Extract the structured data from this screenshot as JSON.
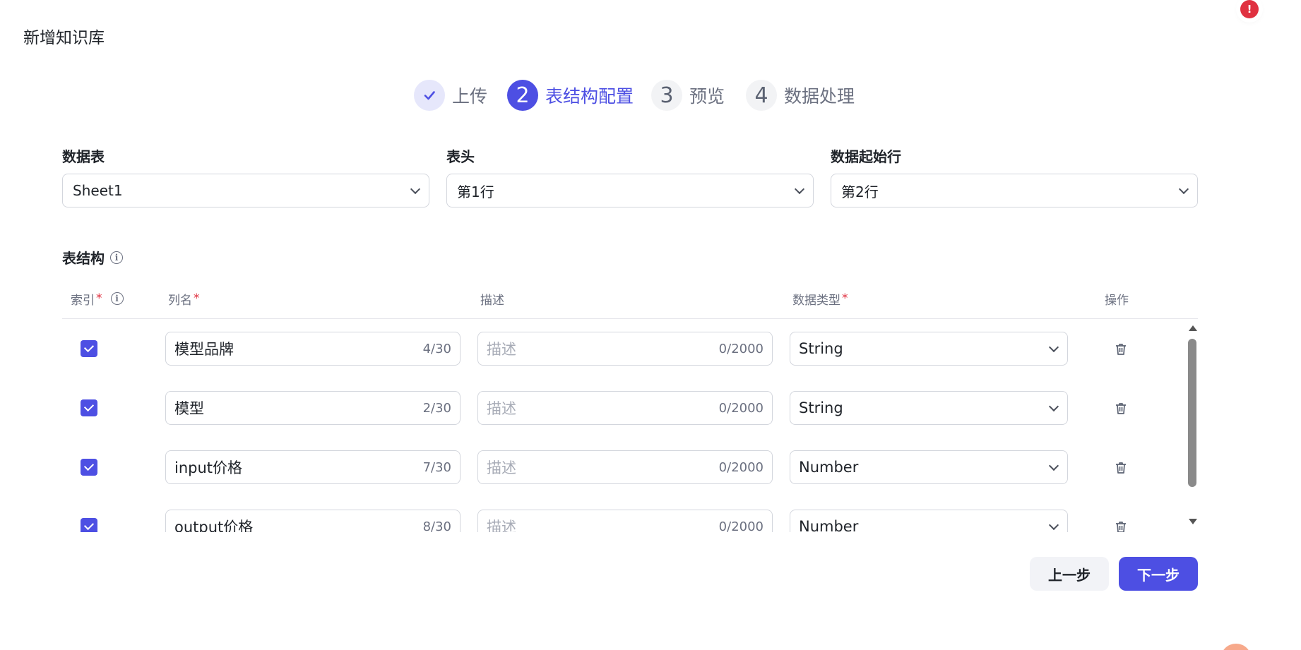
{
  "page": {
    "title": "新增知识库"
  },
  "alert": {
    "symbol": "!"
  },
  "steps": [
    {
      "index": "✓",
      "label": "上传",
      "state": "done"
    },
    {
      "index": "2",
      "label": "表结构配置",
      "state": "active"
    },
    {
      "index": "3",
      "label": "预览",
      "state": "todo"
    },
    {
      "index": "4",
      "label": "数据处理",
      "state": "todo"
    }
  ],
  "config": {
    "sheet": {
      "label": "数据表",
      "value": "Sheet1"
    },
    "header_row": {
      "label": "表头",
      "value": "第1行"
    },
    "start_row": {
      "label": "数据起始行",
      "value": "第2行"
    }
  },
  "schema": {
    "title": "表结构",
    "columns": {
      "index": "索引",
      "name": "列名",
      "description": "描述",
      "type": "数据类型",
      "actions": "操作",
      "required_mark": "*"
    },
    "rows": [
      {
        "checked": true,
        "name": "模型品牌",
        "name_count": "4/30",
        "desc_placeholder": "描述",
        "desc_count": "0/2000",
        "type": "String"
      },
      {
        "checked": true,
        "name": "模型",
        "name_count": "2/30",
        "desc_placeholder": "描述",
        "desc_count": "0/2000",
        "type": "String"
      },
      {
        "checked": true,
        "name": "input价格",
        "name_count": "7/30",
        "desc_placeholder": "描述",
        "desc_count": "0/2000",
        "type": "Number"
      },
      {
        "checked": true,
        "name": "output价格",
        "name_count": "8/30",
        "desc_placeholder": "描述",
        "desc_count": "0/2000",
        "type": "Number"
      }
    ]
  },
  "footer": {
    "prev_label": "上一步",
    "next_label": "下一步"
  },
  "colors": {
    "accent": "#4d4fe3",
    "danger": "#e03140"
  }
}
